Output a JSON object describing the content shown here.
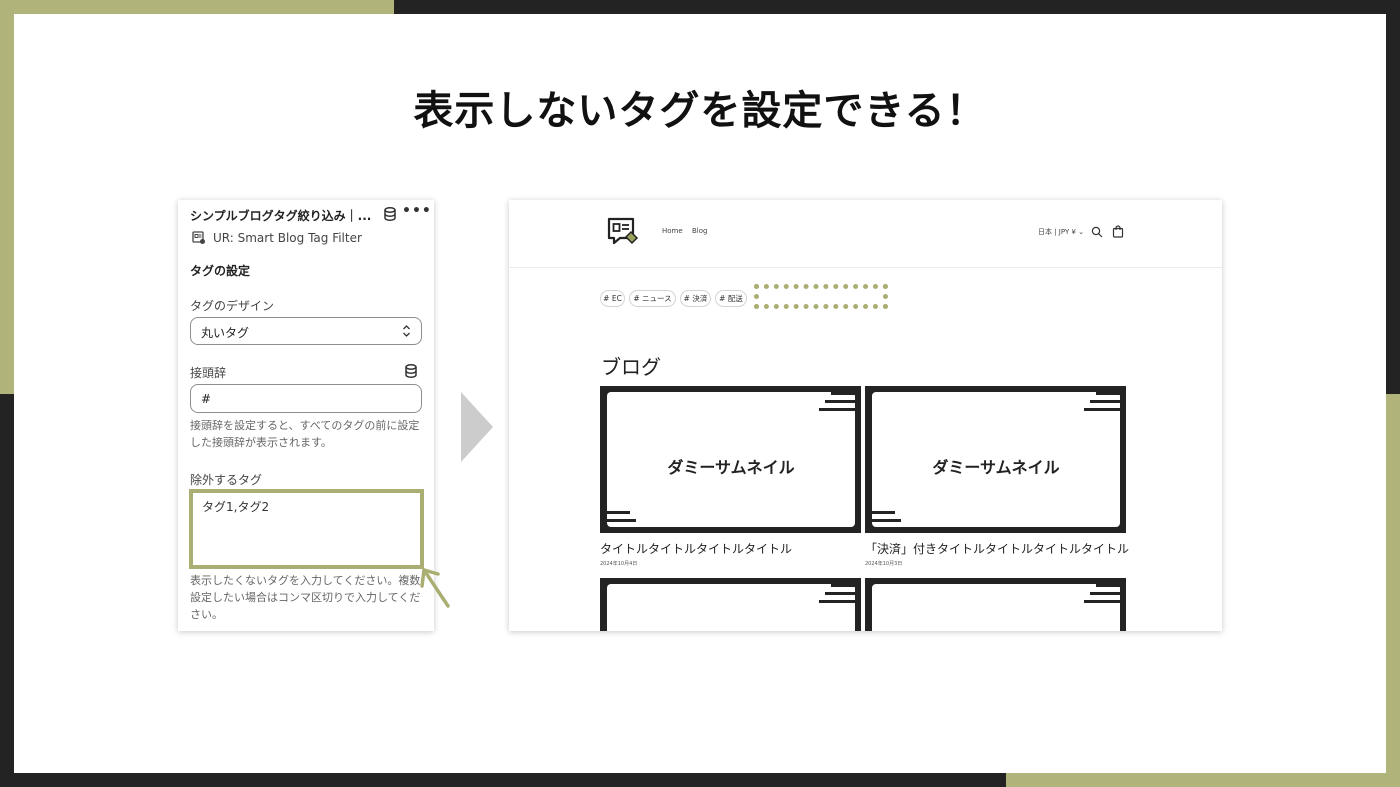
{
  "headline": "表示しないタグを設定できる！",
  "colors": {
    "accent": "#abae72",
    "dark": "#232323",
    "background": "#ffffff"
  },
  "panel": {
    "title": "シンプルブログタグ絞り込み｜...",
    "more_icon": "•••",
    "app_name": "UR: Smart Blog Tag Filter",
    "section_title": "タグの設定",
    "design_label": "タグのデザイン",
    "design_value": "丸いタグ",
    "prefix_label": "接頭辞",
    "prefix_value": "#",
    "prefix_help": "接頭辞を設定すると、すべてのタグの前に設定した接頭辞が表示されます。",
    "exclude_label": "除外するタグ",
    "exclude_value": "タグ1,タグ2",
    "exclude_help": "表示したくないタグを入力してください。複数設定したい場合はコンマ区切りで入力してください。"
  },
  "store": {
    "nav": [
      "Home",
      "Blog"
    ],
    "locale": "日本 | JPY ¥ ⌄",
    "tags": [
      "# EC",
      "# ニュース",
      "# 決済",
      "# 配送"
    ],
    "heading": "ブログ",
    "thumbnail_text": "ダミーサムネイル",
    "posts": [
      {
        "title": "タイトルタイトルタイトルタイトル",
        "date": "2024年10月4日"
      },
      {
        "title": "「決済」付きタイトルタイトルタイトルタイトル",
        "date": "2024年10月3日"
      }
    ]
  }
}
